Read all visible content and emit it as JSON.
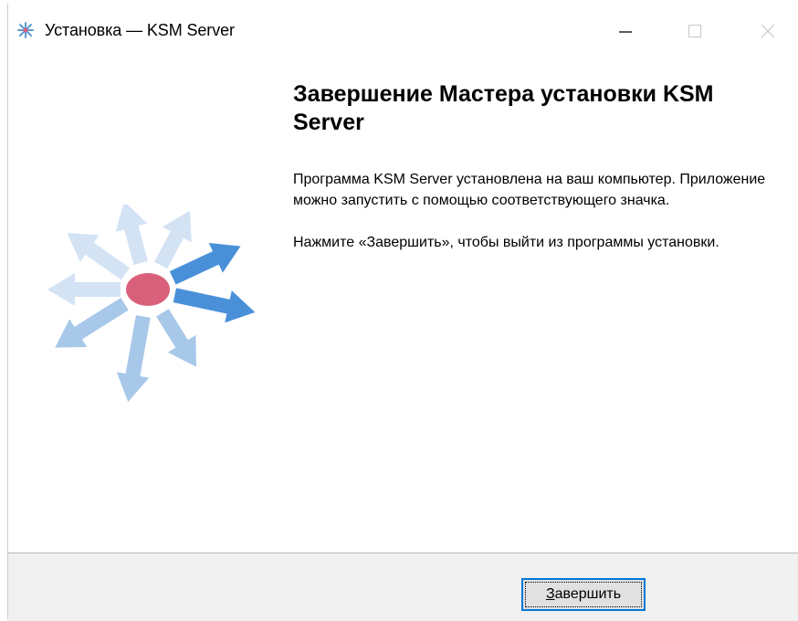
{
  "window": {
    "title": "Установка — KSM Server",
    "controls": {
      "minimize_icon": "minimize-icon",
      "maximize_icon": "maximize-icon",
      "close_icon": "close-icon"
    }
  },
  "page": {
    "heading": "Завершение Мастера установки KSM Server",
    "paragraphs": [
      "Программа KSM Server установлена на ваш компьютер. Приложение можно запустить с помощью соответствующего значка.",
      "Нажмите «Завершить», чтобы выйти из программы установки."
    ]
  },
  "footer": {
    "finish_button": {
      "accel": "З",
      "rest": "авершить"
    }
  },
  "colors": {
    "arrow_light": "#d3e3f4",
    "arrow_mid": "#a8c8ea",
    "arrow_strong": "#4a90d9",
    "center_dot": "#d9607a",
    "button_focus": "#0078d7"
  }
}
